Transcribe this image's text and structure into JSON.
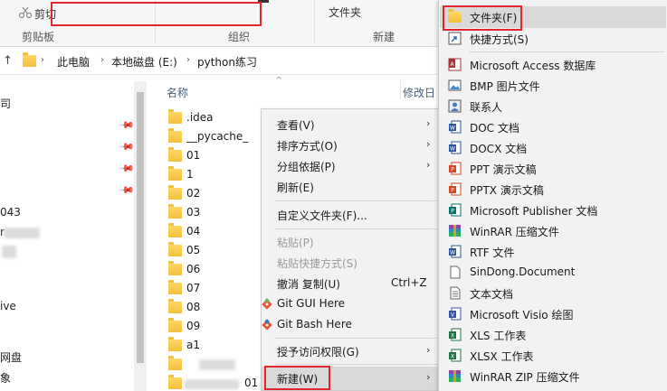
{
  "ribbon": {
    "cut_label": "剪切",
    "clipboard_group": "剪贴板",
    "organize_group": "组织",
    "folder_label": "文件夹",
    "new_group": "新建"
  },
  "address": {
    "crumbs": [
      "此电脑",
      "本地磁盘 (E:)",
      "python练习"
    ]
  },
  "nav": {
    "fragments": [
      "司",
      "043",
      "r",
      "ive",
      "网盘",
      "象"
    ]
  },
  "files": {
    "col_name": "名称",
    "col_modified": "修改日",
    "items": [
      ".idea",
      "__pycache_",
      "01",
      "1",
      "02",
      "03",
      "04",
      "05",
      "06",
      "07",
      "08",
      "09",
      "a1",
      "",
      "01"
    ]
  },
  "context_menu": {
    "items": [
      {
        "label": "查看(V)",
        "arrow": true
      },
      {
        "label": "排序方式(O)",
        "arrow": true
      },
      {
        "label": "分组依据(P)",
        "arrow": true
      },
      {
        "label": "刷新(E)"
      },
      {
        "label": "自定义文件夹(F)..."
      },
      {
        "label": "粘贴(P)",
        "disabled": true
      },
      {
        "label": "粘贴快捷方式(S)",
        "disabled": true
      },
      {
        "label": "撤消 复制(U)",
        "shortcut": "Ctrl+Z"
      },
      {
        "label": "Git GUI Here",
        "icon": "git-icon"
      },
      {
        "label": "Git Bash Here",
        "icon": "git-icon"
      },
      {
        "label": "授予访问权限(G)",
        "arrow": true
      },
      {
        "label": "新建(W)",
        "arrow": true,
        "active": true
      }
    ],
    "arrow_glyph": "›"
  },
  "submenu": {
    "items": [
      {
        "label": "文件夹(F)",
        "icon": "folder-icon",
        "active": true
      },
      {
        "label": "快捷方式(S)",
        "icon": "shortcut-icon"
      },
      {
        "label": "Microsoft Access 数据库",
        "icon": "access-icon"
      },
      {
        "label": "BMP 图片文件",
        "icon": "bmp-icon"
      },
      {
        "label": "联系人",
        "icon": "contact-icon"
      },
      {
        "label": "DOC 文档",
        "icon": "word-icon"
      },
      {
        "label": "DOCX 文档",
        "icon": "word-icon"
      },
      {
        "label": "PPT 演示文稿",
        "icon": "powerpoint-icon"
      },
      {
        "label": "PPTX 演示文稿",
        "icon": "powerpoint-icon"
      },
      {
        "label": "Microsoft Publisher 文档",
        "icon": "publisher-icon"
      },
      {
        "label": "WinRAR 压缩文件",
        "icon": "winrar-icon"
      },
      {
        "label": "RTF 文件",
        "icon": "rtf-icon"
      },
      {
        "label": "SinDong.Document",
        "icon": "document-icon"
      },
      {
        "label": "文本文档",
        "icon": "text-icon"
      },
      {
        "label": "Microsoft Visio 绘图",
        "icon": "visio-icon"
      },
      {
        "label": "XLS 工作表",
        "icon": "excel-icon"
      },
      {
        "label": "XLSX 工作表",
        "icon": "excel-icon"
      },
      {
        "label": "WinRAR ZIP 压缩文件",
        "icon": "winrar-zip-icon"
      }
    ]
  },
  "colors": {
    "highlight_red": "#e3262d",
    "folder_yellow": "#f2c03c",
    "menu_bg": "#f2f2f2",
    "menu_active": "#d9d9d9"
  }
}
